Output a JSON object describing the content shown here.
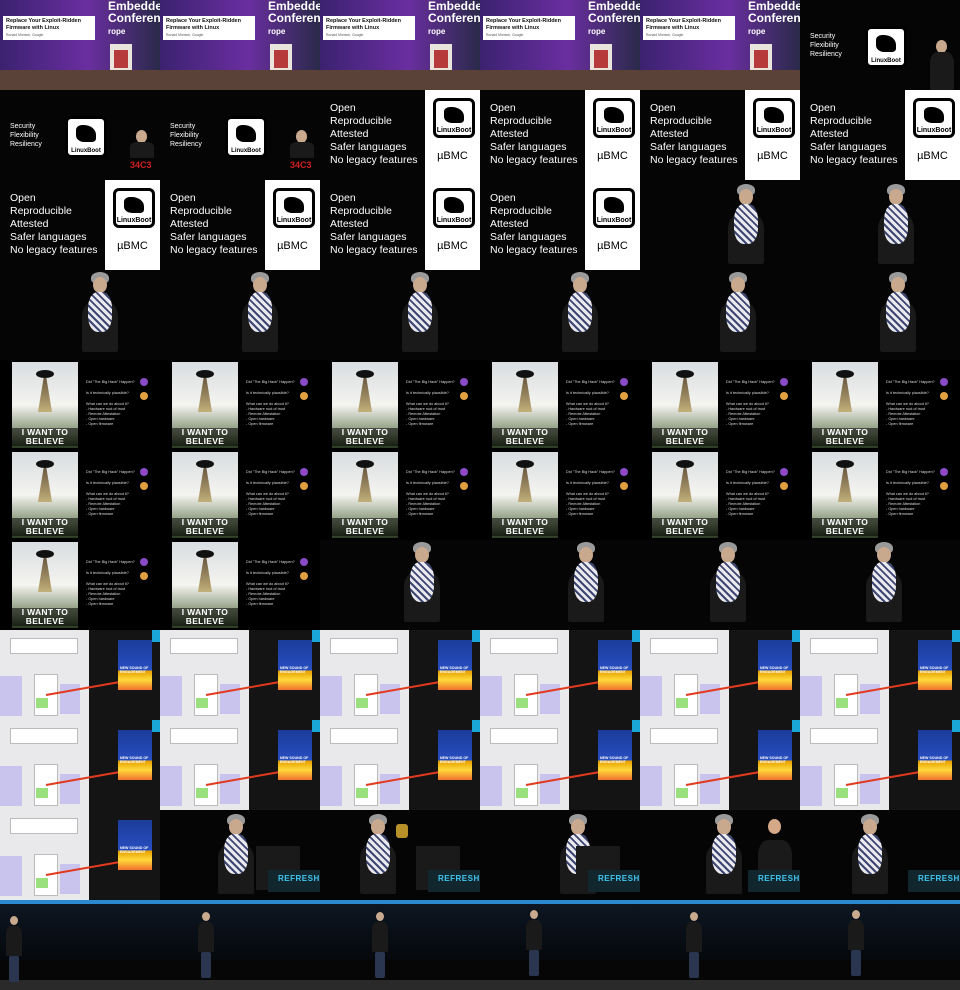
{
  "conference": {
    "talk_title": "Replace Your Exploit-Ridden Firmware with Linux",
    "speaker_line": "Ronald Minnich, Google",
    "banner_line1": "Embedde",
    "banner_line2": "Conferen",
    "banner_line3": "rope"
  },
  "linuxboot": {
    "logo_text": "LinuxBoot",
    "list_a": [
      "Security",
      "Flexibility",
      "Resiliency"
    ],
    "list_b": [
      "Open",
      "Reproducible",
      "Attested",
      "Safer languages",
      "No legacy features"
    ],
    "ubmc": "µBMC",
    "ccc_logo": "34C3"
  },
  "believe": {
    "poster_line1": "I WANT TO",
    "poster_line2": "BELIEVE",
    "questions": [
      "Did \"The Big Hack\" Happen?",
      "Is it technically plausible?",
      "What can we do about it?",
      "- Hardware root of trust",
      "- Remote Attestation",
      "- Open hardware",
      "- Open firmware"
    ]
  },
  "map": {
    "poster_text": "NEW SOUND OF ENGAGEMENT"
  },
  "stage": {
    "screen_text": "REFRESHIN"
  }
}
